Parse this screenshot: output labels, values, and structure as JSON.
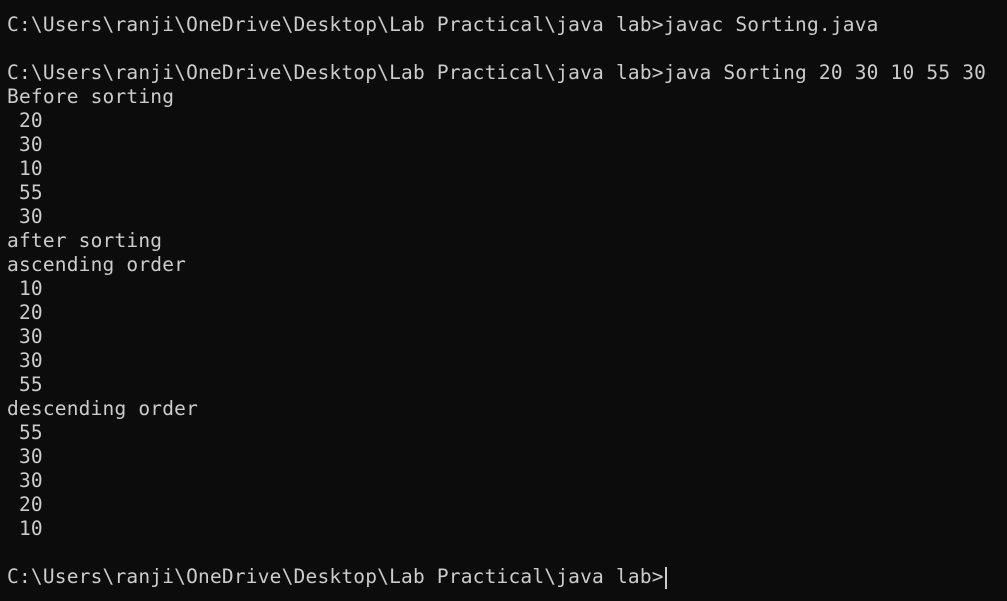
{
  "terminal": {
    "lines": [
      "C:\\Users\\ranji\\OneDrive\\Desktop\\Lab Practical\\java lab>javac Sorting.java",
      "",
      "C:\\Users\\ranji\\OneDrive\\Desktop\\Lab Practical\\java lab>java Sorting 20 30 10 55 30",
      "Before sorting",
      " 20",
      " 30",
      " 10",
      " 55",
      " 30",
      "after sorting",
      "ascending order",
      " 10",
      " 20",
      " 30",
      " 30",
      " 55",
      "descending order",
      " 55",
      " 30",
      " 30",
      " 20",
      " 10",
      "",
      "C:\\Users\\ranji\\OneDrive\\Desktop\\Lab Practical\\java lab>"
    ]
  }
}
